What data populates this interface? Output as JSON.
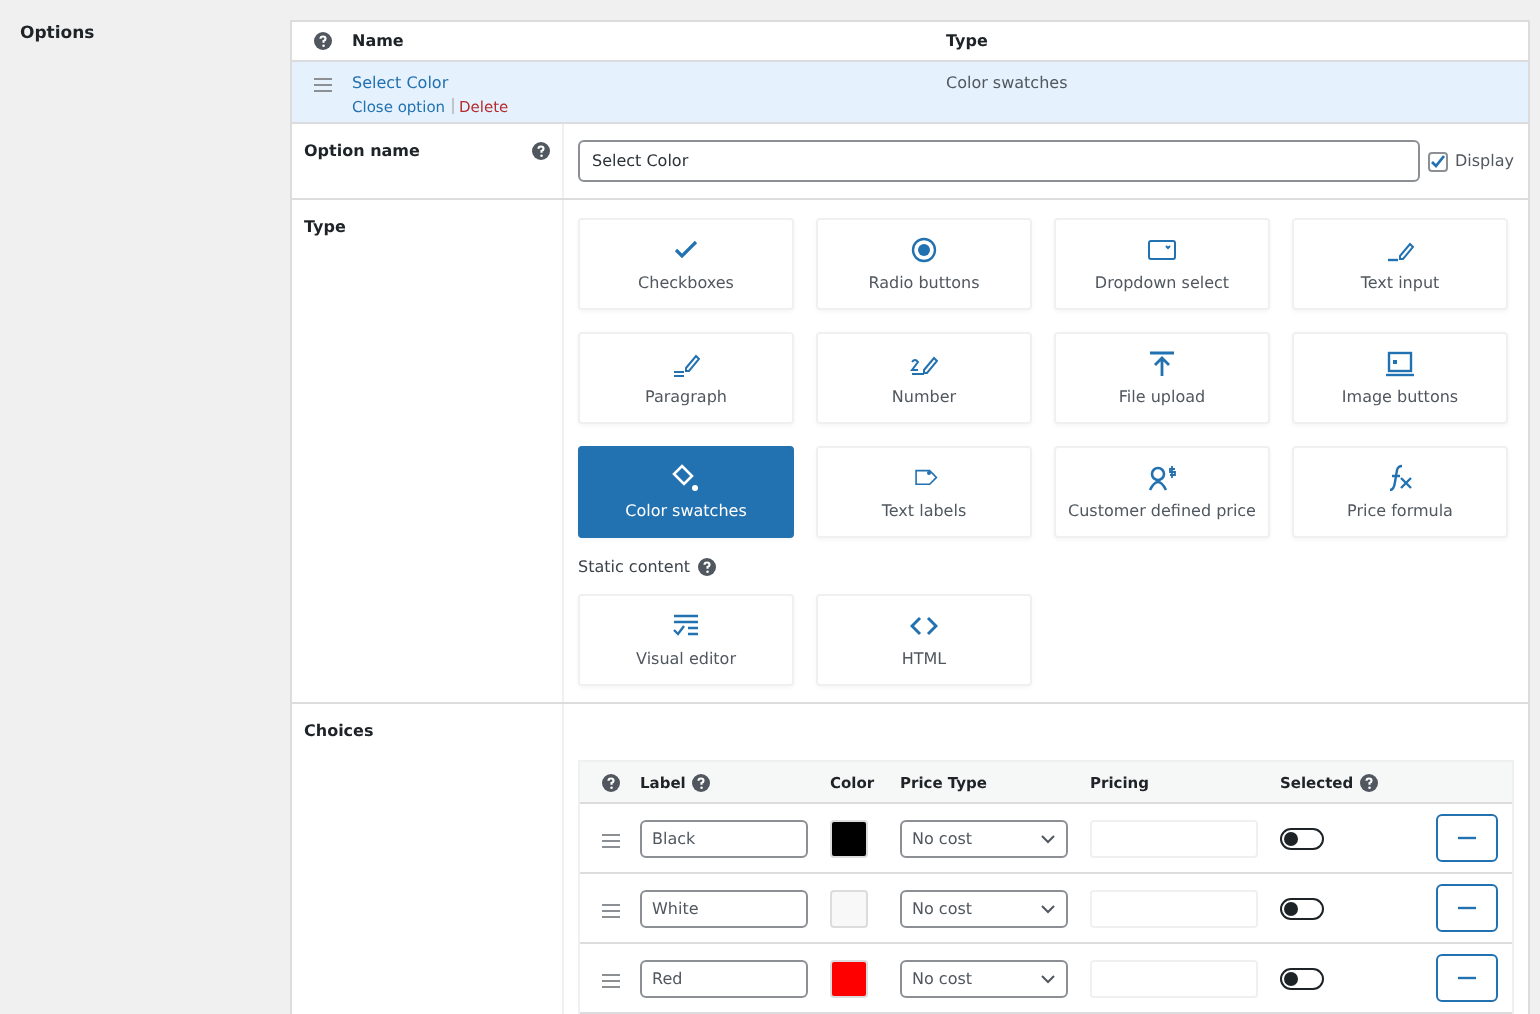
{
  "section_label": "Options",
  "options_table": {
    "columns": [
      "Name",
      "Type"
    ],
    "rows": [
      {
        "name": "Select Color",
        "type": "Color swatches",
        "selected": true,
        "actions": [
          {
            "label": "Close option",
            "kind": "link"
          },
          {
            "label": "Delete",
            "kind": "danger"
          }
        ]
      }
    ]
  },
  "option_name": {
    "label": "Option name",
    "value": "Select Color",
    "display_label": "Display",
    "display_checked": true
  },
  "type": {
    "label": "Type",
    "cards": [
      {
        "label": "Checkboxes",
        "selected": false
      },
      {
        "label": "Radio buttons",
        "selected": false
      },
      {
        "label": "Dropdown select",
        "selected": false
      },
      {
        "label": "Text input",
        "selected": false
      },
      {
        "label": "Paragraph",
        "selected": false
      },
      {
        "label": "Number",
        "selected": false
      },
      {
        "label": "File upload",
        "selected": false
      },
      {
        "label": "Image buttons",
        "selected": false
      },
      {
        "label": "Color swatches",
        "selected": true
      },
      {
        "label": "Text labels",
        "selected": false
      },
      {
        "label": "Customer defined price",
        "selected": false
      },
      {
        "label": "Price formula",
        "selected": false
      }
    ],
    "static_label": "Static content",
    "static_cards": [
      {
        "label": "Visual editor",
        "selected": false
      },
      {
        "label": "HTML",
        "selected": false
      }
    ]
  },
  "choices": {
    "label": "Choices",
    "columns": [
      "Label",
      "Color",
      "Price Type",
      "Pricing",
      "Selected"
    ],
    "rows": [
      {
        "label": "Black",
        "color": "#000000",
        "price_type": "No cost",
        "pricing": "",
        "on": false
      },
      {
        "label": "White",
        "color": "#f8f8f8",
        "price_type": "No cost",
        "pricing": "",
        "on": false
      },
      {
        "label": "Red",
        "color": "#ff0000",
        "price_type": "No cost",
        "pricing": "",
        "on": false
      }
    ]
  }
}
